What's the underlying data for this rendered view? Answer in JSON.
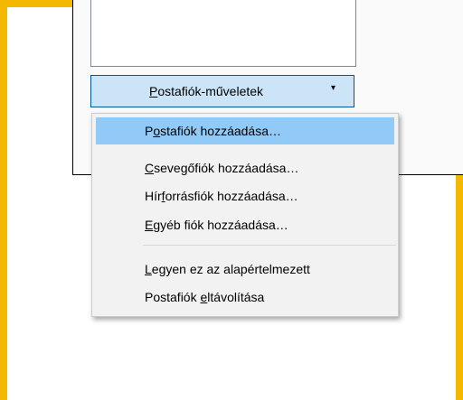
{
  "actions_button": {
    "label_accel": "P",
    "label_rest": "ostafiók-műveletek",
    "chevron": "▾"
  },
  "menu": {
    "items": [
      {
        "pre": "P",
        "acc": "o",
        "post": "stafiók hozzáadása…"
      },
      {
        "pre": "",
        "acc": "C",
        "post": "sevegőfiók hozzáadása…"
      },
      {
        "pre": "Hír",
        "acc": "f",
        "post": "orrásfiók hozzáadása…"
      },
      {
        "pre": "",
        "acc": "E",
        "post": "gyéb fiók hozzáadása…"
      },
      {
        "pre": "",
        "acc": "L",
        "post": "egyen ez az alapértelmezett"
      },
      {
        "pre": "Postafiók ",
        "acc": "e",
        "post": "ltávolítása"
      }
    ]
  },
  "colors": {
    "accent_yellow": "#f5b800",
    "button_bg": "#cce4f7",
    "button_border": "#005499",
    "menu_bg": "#f2f2f2",
    "menu_highlight": "#91c9f7"
  }
}
